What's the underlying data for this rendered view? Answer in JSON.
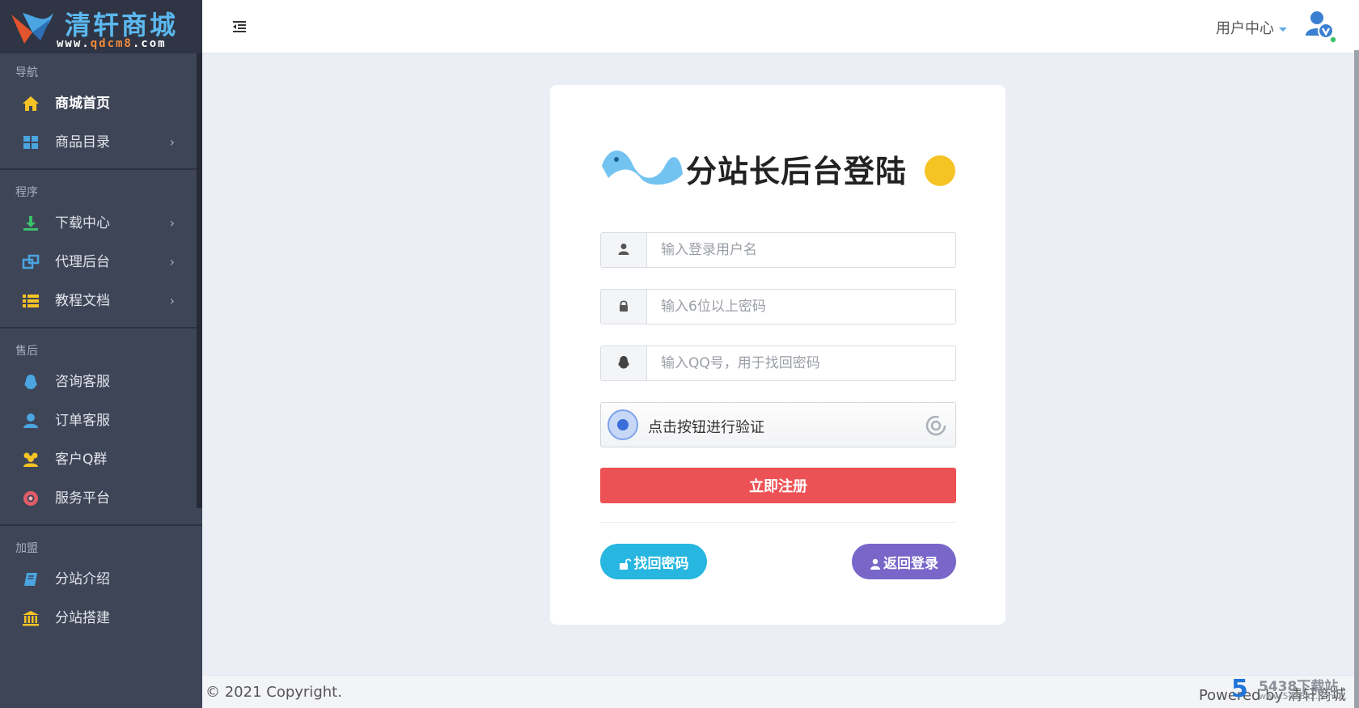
{
  "brand": {
    "title": "清轩商城",
    "url_prefix": "www.",
    "url_mid": "qdcm8",
    "url_suffix": ".com"
  },
  "sidebar": {
    "groups": [
      {
        "title": "导航",
        "items": [
          {
            "label": "商城首页",
            "icon": "home-icon",
            "active": true
          },
          {
            "label": "商品目录",
            "icon": "grid-icon",
            "arrow": true
          }
        ]
      },
      {
        "title": "程序",
        "items": [
          {
            "label": "下载中心",
            "icon": "download-icon",
            "arrow": true
          },
          {
            "label": "代理后台",
            "icon": "windows-icon",
            "arrow": true
          },
          {
            "label": "教程文档",
            "icon": "list-icon",
            "arrow": true
          }
        ]
      },
      {
        "title": "售后",
        "items": [
          {
            "label": "咨询客服",
            "icon": "qq-icon"
          },
          {
            "label": "订单客服",
            "icon": "user-icon"
          },
          {
            "label": "客户Q群",
            "icon": "users-icon"
          },
          {
            "label": "服务平台",
            "icon": "support-icon"
          }
        ]
      },
      {
        "title": "加盟",
        "items": [
          {
            "label": "分站介绍",
            "icon": "book-icon"
          },
          {
            "label": "分站搭建",
            "icon": "bank-icon"
          }
        ]
      }
    ]
  },
  "topbar": {
    "user_center": "用户中心"
  },
  "form": {
    "banner_title": "分站长后台登陆",
    "username_placeholder": "输入登录用户名",
    "password_placeholder": "输入6位以上密码",
    "qq_placeholder": "输入QQ号，用于找回密码",
    "captcha_text": "点击按钮进行验证",
    "register_label": "立即注册",
    "forgot_label": "找回密码",
    "back_label": "返回登录"
  },
  "footer": {
    "copyright": "© 2021 Copyright.",
    "powered": "Powered by 清轩商城"
  },
  "watermark": {
    "mark": "5",
    "text": "5438下载站",
    "url": "www.5438xz.com"
  },
  "colors": {
    "sidebar_bg": "#3e4557",
    "register": "#ec5255",
    "forgot": "#27b6e0",
    "back": "#7866c9"
  }
}
